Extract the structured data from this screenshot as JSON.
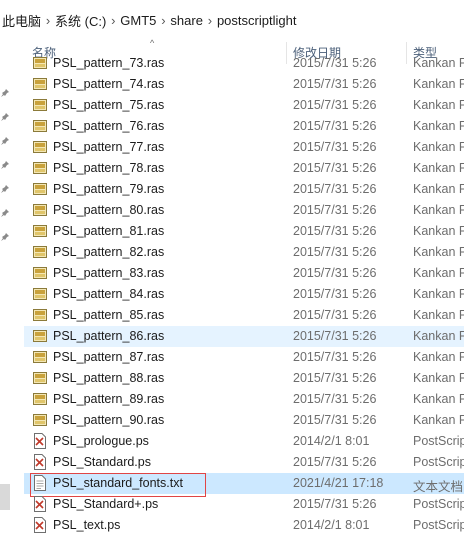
{
  "breadcrumb": {
    "items": [
      "此电脑",
      "系统 (C:)",
      "GMT5",
      "share",
      "postscriptlight"
    ],
    "separator": "›"
  },
  "columns": {
    "name": "名称",
    "date": "修改日期",
    "type": "类型",
    "sort_glyph": "^"
  },
  "colors": {
    "hover_row": "#e5f3ff",
    "selected_row": "#cce8ff",
    "outline": "#e04545",
    "header_text": "#4c607a"
  },
  "files": [
    {
      "name": "PSL_pattern_73.ras",
      "date": "2015/7/31 5:26",
      "type": "Kankan F",
      "icon": "ras-icon"
    },
    {
      "name": "PSL_pattern_74.ras",
      "date": "2015/7/31 5:26",
      "type": "Kankan F",
      "icon": "ras-icon"
    },
    {
      "name": "PSL_pattern_75.ras",
      "date": "2015/7/31 5:26",
      "type": "Kankan F",
      "icon": "ras-icon"
    },
    {
      "name": "PSL_pattern_76.ras",
      "date": "2015/7/31 5:26",
      "type": "Kankan F",
      "icon": "ras-icon"
    },
    {
      "name": "PSL_pattern_77.ras",
      "date": "2015/7/31 5:26",
      "type": "Kankan F",
      "icon": "ras-icon"
    },
    {
      "name": "PSL_pattern_78.ras",
      "date": "2015/7/31 5:26",
      "type": "Kankan F",
      "icon": "ras-icon"
    },
    {
      "name": "PSL_pattern_79.ras",
      "date": "2015/7/31 5:26",
      "type": "Kankan F",
      "icon": "ras-icon"
    },
    {
      "name": "PSL_pattern_80.ras",
      "date": "2015/7/31 5:26",
      "type": "Kankan F",
      "icon": "ras-icon"
    },
    {
      "name": "PSL_pattern_81.ras",
      "date": "2015/7/31 5:26",
      "type": "Kankan F",
      "icon": "ras-icon"
    },
    {
      "name": "PSL_pattern_82.ras",
      "date": "2015/7/31 5:26",
      "type": "Kankan F",
      "icon": "ras-icon"
    },
    {
      "name": "PSL_pattern_83.ras",
      "date": "2015/7/31 5:26",
      "type": "Kankan F",
      "icon": "ras-icon"
    },
    {
      "name": "PSL_pattern_84.ras",
      "date": "2015/7/31 5:26",
      "type": "Kankan F",
      "icon": "ras-icon"
    },
    {
      "name": "PSL_pattern_85.ras",
      "date": "2015/7/31 5:26",
      "type": "Kankan F",
      "icon": "ras-icon"
    },
    {
      "name": "PSL_pattern_86.ras",
      "date": "2015/7/31 5:26",
      "type": "Kankan F",
      "icon": "ras-icon",
      "hover": true
    },
    {
      "name": "PSL_pattern_87.ras",
      "date": "2015/7/31 5:26",
      "type": "Kankan F",
      "icon": "ras-icon"
    },
    {
      "name": "PSL_pattern_88.ras",
      "date": "2015/7/31 5:26",
      "type": "Kankan F",
      "icon": "ras-icon"
    },
    {
      "name": "PSL_pattern_89.ras",
      "date": "2015/7/31 5:26",
      "type": "Kankan F",
      "icon": "ras-icon"
    },
    {
      "name": "PSL_pattern_90.ras",
      "date": "2015/7/31 5:26",
      "type": "Kankan F",
      "icon": "ras-icon"
    },
    {
      "name": "PSL_prologue.ps",
      "date": "2014/2/1 8:01",
      "type": "PostScrip",
      "icon": "ps-icon"
    },
    {
      "name": "PSL_Standard.ps",
      "date": "2015/7/31 5:26",
      "type": "PostScrip",
      "icon": "ps-icon"
    },
    {
      "name": "PSL_standard_fonts.txt",
      "date": "2021/4/21 17:18",
      "type": "文本文档",
      "icon": "txt-icon",
      "selected": true
    },
    {
      "name": "PSL_Standard+.ps",
      "date": "2015/7/31 5:26",
      "type": "PostScrip",
      "icon": "ps-icon"
    },
    {
      "name": "PSL_text.ps",
      "date": "2014/2/1 8:01",
      "type": "PostScrip",
      "icon": "ps-icon"
    }
  ]
}
